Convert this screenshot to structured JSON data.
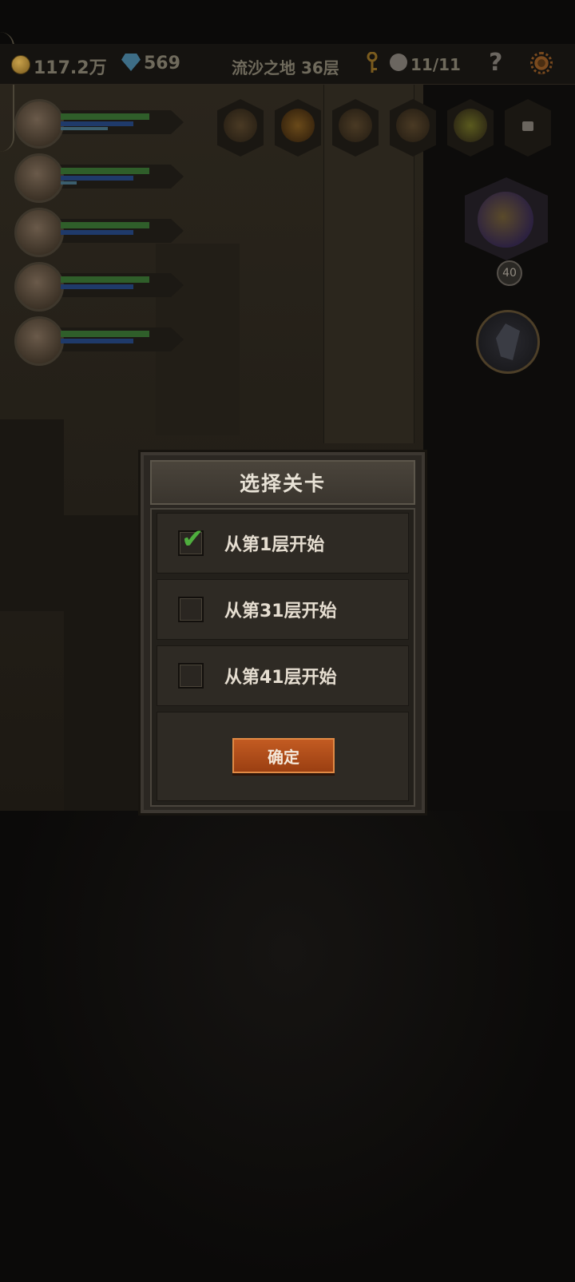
{
  "hud": {
    "gold": "117.2万",
    "gems": "569",
    "location": "流沙之地 36层",
    "kills": "11/11",
    "help": "?"
  },
  "heroes": [
    {
      "hp": 0.85,
      "mp": 0.7,
      "extra": 0.45
    },
    {
      "hp": 0.85,
      "mp": 0.7,
      "extra": 0.15
    },
    {
      "hp": 0.85,
      "mp": 0.7,
      "extra": 0.0
    },
    {
      "hp": 0.85,
      "mp": 0.7,
      "extra": 0.0
    },
    {
      "hp": 0.85,
      "mp": 0.7,
      "extra": 0.0
    }
  ],
  "item_slots": [
    "coffin-icon",
    "pumpkin-icon",
    "scroll-icon",
    "bell-icon",
    "feather-icon",
    "lock-icon"
  ],
  "boss": {
    "level": "40"
  },
  "dialog": {
    "title": "选择关卡",
    "options": [
      {
        "label": "从第1层开始",
        "checked": true
      },
      {
        "label": "从第31层开始",
        "checked": false
      },
      {
        "label": "从第41层开始",
        "checked": false
      }
    ],
    "confirm_label": "确定"
  }
}
